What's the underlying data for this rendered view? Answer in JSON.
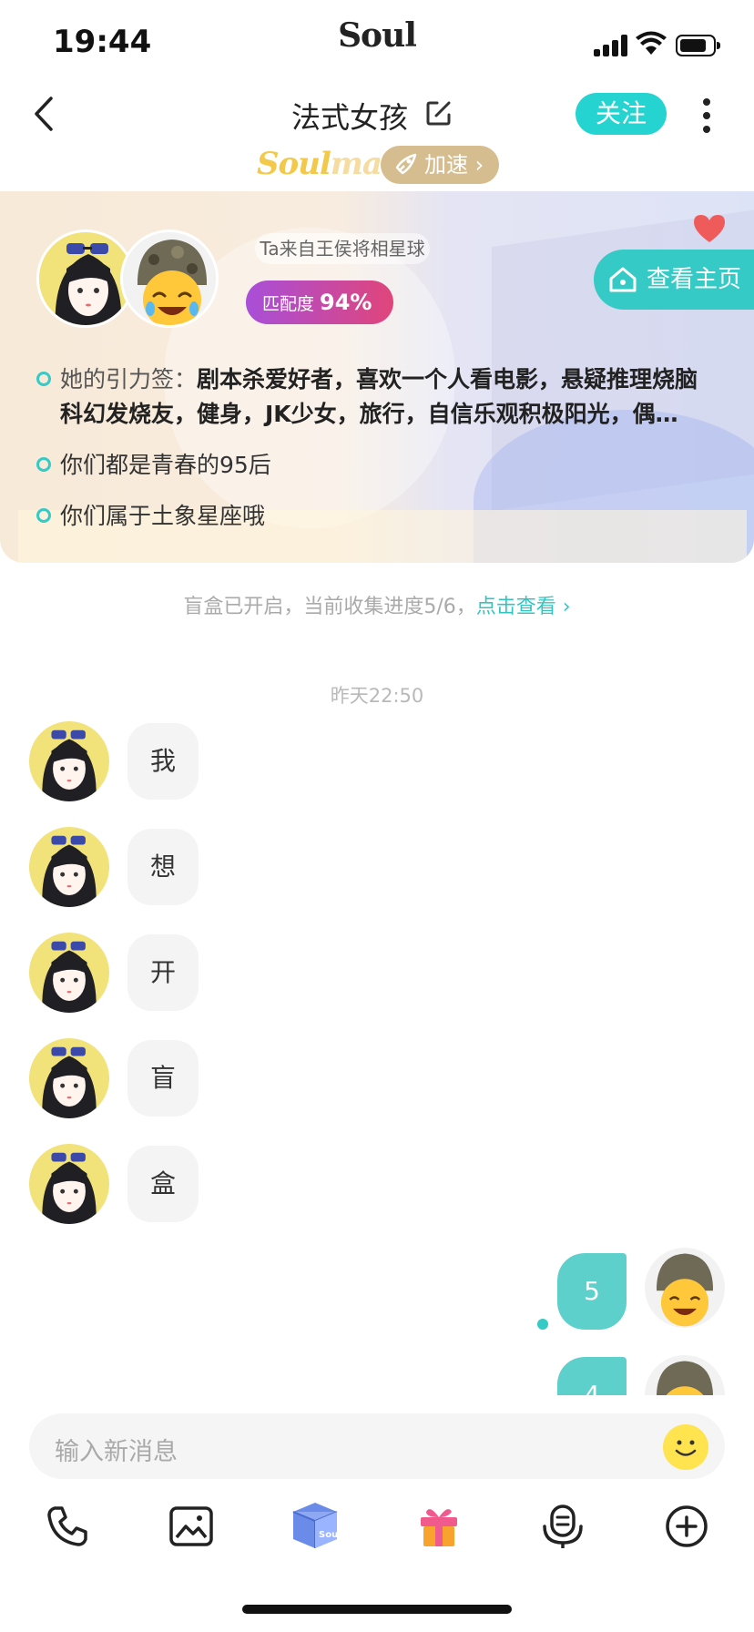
{
  "status_bar": {
    "time": "19:44",
    "brand": "Soul"
  },
  "nav": {
    "title": "法式女孩",
    "follow_label": "关注"
  },
  "soulmate": {
    "part1": "Soul",
    "part2": "mate",
    "accelerate_label": "加速"
  },
  "profile": {
    "planet": "Ta来自王侯将相星球",
    "match_label": "匹配度",
    "match_value": "94%",
    "homepage_label": "查看主页",
    "tags_prefix": "她的引力签：",
    "tags_line1": "剧本杀爱好者，喜欢一个人看电影，悬疑推理烧脑",
    "tags_line2": "科幻发烧友，健身，JK少女，旅行，自信乐观积极阳光，偶…",
    "fact1": "你们都是青春的95后",
    "fact2": "你们属于土象星座哦"
  },
  "blindbox": {
    "text": "盲盒已开启，当前收集进度5/6，",
    "link": "点击查看"
  },
  "timestamp": "昨天22:50",
  "messages_in": [
    "我",
    "想",
    "开",
    "盲",
    "盒"
  ],
  "messages_out": [
    "5",
    "4"
  ],
  "input": {
    "placeholder": "输入新消息"
  },
  "toolbar": [
    "phone-icon",
    "image-icon",
    "blindbox-icon",
    "gift-icon",
    "voice-icon",
    "plus-icon"
  ],
  "colors": {
    "accent": "#35cac5",
    "follow": "#25d4d0",
    "match_start": "#a84fd9",
    "match_end": "#e0457a"
  }
}
